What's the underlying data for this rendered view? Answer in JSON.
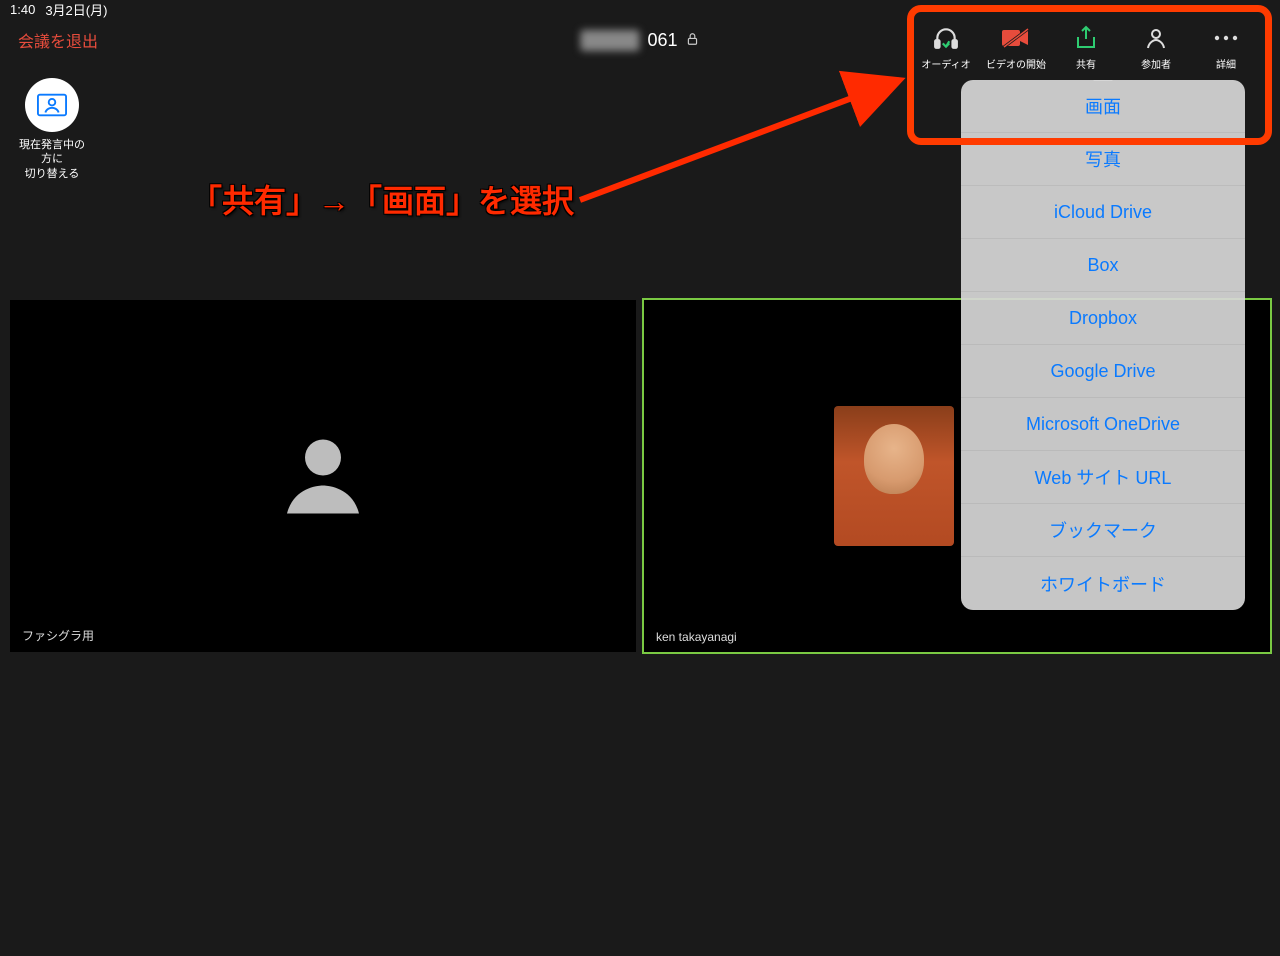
{
  "status": {
    "time": "1:40",
    "date": "3月2日(月)"
  },
  "header": {
    "leave_label": "会議を退出",
    "title_blur": "████",
    "title_visible": "061",
    "lock_icon": "lock"
  },
  "speaker_switch": {
    "label": "現在発言中の\n方に\n切り替える"
  },
  "toolbar": {
    "items": [
      {
        "name": "audio",
        "label": "オーディオ",
        "color": "#2ecc71"
      },
      {
        "name": "video",
        "label": "ビデオの開始",
        "color": "#e74c3c"
      },
      {
        "name": "share",
        "label": "共有",
        "color": "#2ecc71"
      },
      {
        "name": "participants",
        "label": "参加者",
        "color": "#ddd"
      },
      {
        "name": "more",
        "label": "詳細",
        "color": "#ddd"
      }
    ]
  },
  "annotation": {
    "text": "「共有」→「画面」を選択"
  },
  "share_popover": {
    "items": [
      "画面",
      "写真",
      "iCloud Drive",
      "Box",
      "Dropbox",
      "Google Drive",
      "Microsoft OneDrive",
      "Web サイト URL",
      "ブックマーク",
      "ホワイトボード"
    ]
  },
  "videos": {
    "tiles": [
      {
        "name": "ファシグラ用",
        "active": false,
        "placeholder": true
      },
      {
        "name": "ken takayanagi",
        "active": true,
        "placeholder": false
      }
    ]
  }
}
